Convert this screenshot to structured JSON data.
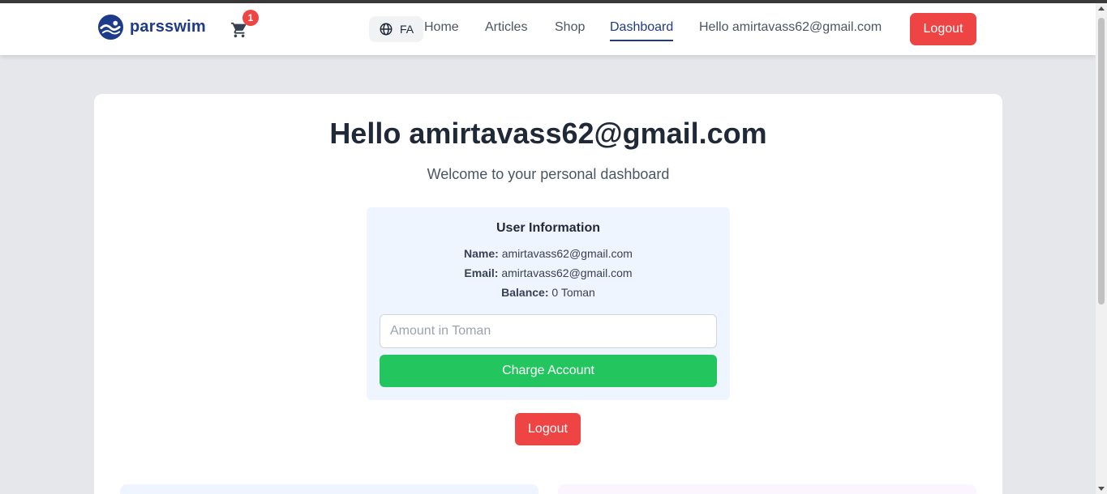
{
  "header": {
    "brand": "parsswim",
    "cart_count": "1",
    "language": "FA",
    "nav": [
      {
        "label": "Home"
      },
      {
        "label": "Articles"
      },
      {
        "label": "Shop"
      },
      {
        "label": "Dashboard",
        "active": true
      }
    ],
    "greeting": "Hello amirtavass62@gmail.com",
    "logout_label": "Logout"
  },
  "dashboard": {
    "title": "Hello amirtavass62@gmail.com",
    "subtitle": "Welcome to your personal dashboard",
    "user_info": {
      "title": "User Information",
      "name_label": "Name:",
      "name_value": "amirtavass62@gmail.com",
      "email_label": "Email:",
      "email_value": "amirtavass62@gmail.com",
      "balance_label": "Balance:",
      "balance_value": "0 Toman"
    },
    "amount_placeholder": "Amount in Toman",
    "charge_label": "Charge Account",
    "logout_label": "Logout"
  },
  "colors": {
    "brand": "#1e3a8a",
    "danger": "#ef4444",
    "success": "#22c55e",
    "background": "#e5e7eb"
  },
  "icons": {
    "logo": "swimmer-logo-icon",
    "cart": "shopping-cart-icon",
    "language": "globe-icon"
  }
}
